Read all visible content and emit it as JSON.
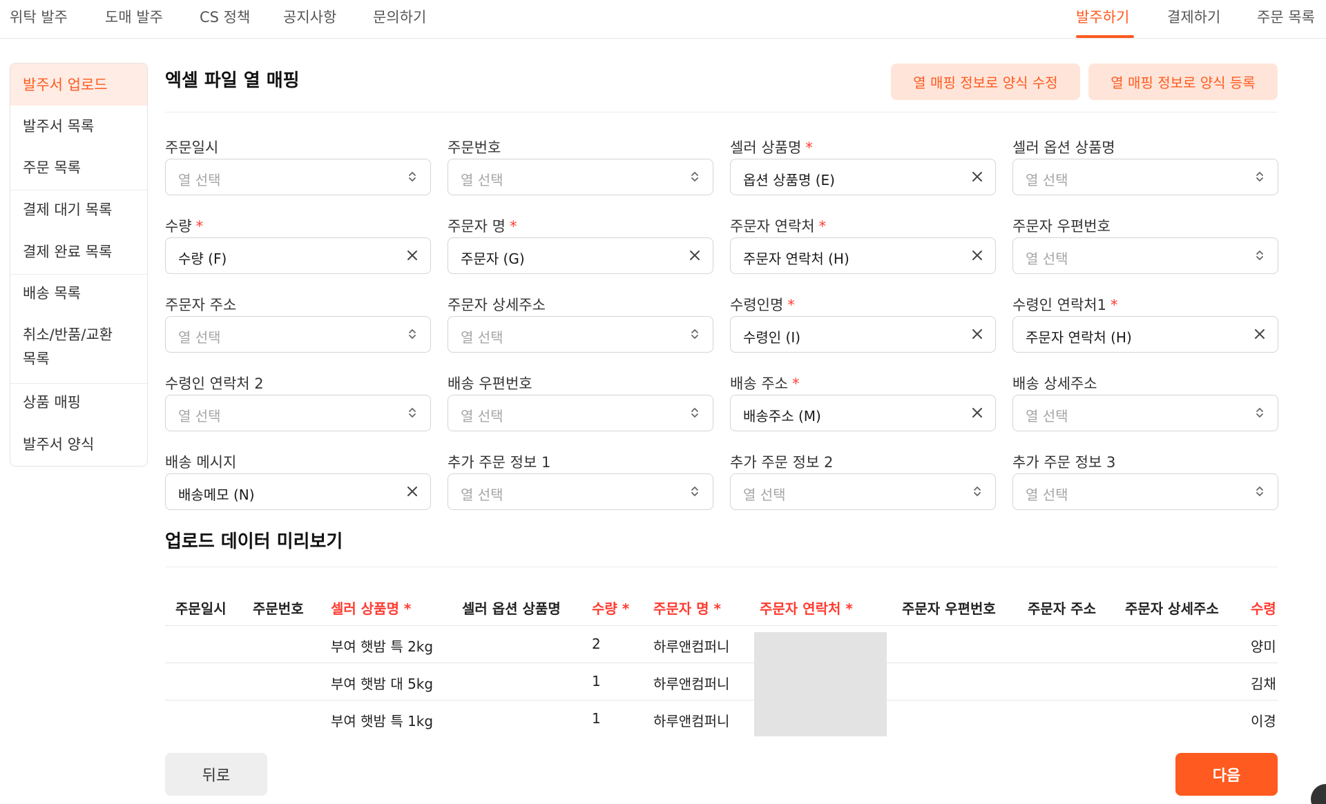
{
  "topnav": {
    "left": [
      "위탁 발주",
      "도매 발주",
      "CS 정책",
      "공지사항",
      "문의하기"
    ],
    "right": [
      "발주하기",
      "결제하기",
      "주문 목록"
    ],
    "active": "발주하기"
  },
  "sidebar": {
    "items": [
      "발주서 업로드",
      "발주서 목록",
      "주문 목록",
      "결제 대기 목록",
      "결제 완료 목록",
      "배송 목록",
      "취소/반품/교환",
      "목록",
      "상품 매핑",
      "발주서 양식"
    ],
    "active": "발주서 업로드"
  },
  "mapping": {
    "title": "엑셀 파일 열 매핑",
    "edit_button": "열 매핑 정보로 양식 수정",
    "register_button": "열 매핑 정보로 양식 등록",
    "placeholder": "열 선택",
    "required_mark": "*",
    "fields": [
      {
        "label": "주문일시",
        "value": ""
      },
      {
        "label": "주문번호",
        "value": ""
      },
      {
        "label": "셀러 상품명",
        "value": "옵션 상품명 (E)"
      },
      {
        "label": "셀러 옵션 상품명",
        "value": ""
      },
      {
        "label": "수량",
        "value": "수량 (F)"
      },
      {
        "label": "주문자 명",
        "value": "주문자 (G)"
      },
      {
        "label": "주문자 연락처",
        "value": "주문자 연락처 (H)"
      },
      {
        "label": "주문자 우편번호",
        "value": ""
      },
      {
        "label": "주문자 주소",
        "value": ""
      },
      {
        "label": "주문자 상세주소",
        "value": ""
      },
      {
        "label": "수령인명",
        "value": "수령인 (I)"
      },
      {
        "label": "수령인 연락처1",
        "value": "주문자 연락처 (H)"
      },
      {
        "label": "수령인 연락처 2",
        "value": ""
      },
      {
        "label": "배송 우편번호",
        "value": ""
      },
      {
        "label": "배송 주소",
        "value": "배송주소 (M)"
      },
      {
        "label": "배송 상세주소",
        "value": ""
      },
      {
        "label": "배송 메시지",
        "value": "배송메모 (N)"
      },
      {
        "label": "추가 주문 정보 1",
        "value": ""
      },
      {
        "label": "추가 주문 정보 2",
        "value": ""
      },
      {
        "label": "추가 주문 정보 3",
        "value": ""
      }
    ]
  },
  "preview": {
    "title": "업로드 데이터 미리보기",
    "columns": [
      "주문일시",
      "주문번호",
      "셀러 상품명 *",
      "셀러 옵션 상품명",
      "수량 *",
      "주문자 명 *",
      "주문자 연락처 *",
      "주문자 우편번호",
      "주문자 주소",
      "주문자 상세주소",
      "수령"
    ],
    "rows": [
      {
        "product": "부여 햇밤 특 2kg",
        "qty": "2",
        "orderer": "하루앤컴퍼니",
        "recipient": "양미"
      },
      {
        "product": "부여 햇밤 대 5kg",
        "qty": "1",
        "orderer": "하루앤컴퍼니",
        "recipient": "김채"
      },
      {
        "product": "부여 햇밤 특 1kg",
        "qty": "1",
        "orderer": "하루앤컴퍼니",
        "recipient": "이경"
      }
    ]
  },
  "footer": {
    "back": "뒤로",
    "next": "다음"
  },
  "colors": {
    "accent": "#ff5a1f",
    "required": "#ff3b30",
    "accent_light": "#ffe5d9"
  }
}
